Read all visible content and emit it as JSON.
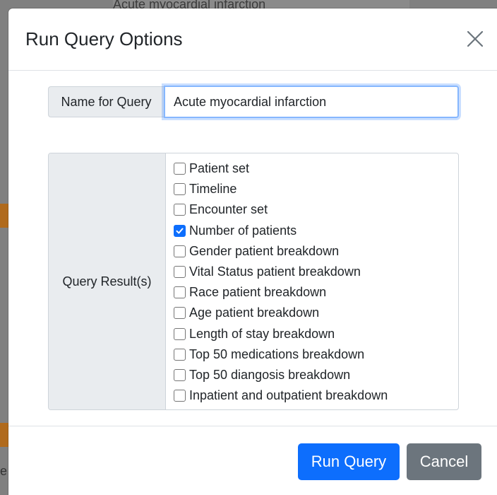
{
  "background": {
    "top_text": "Acute myocardial infarction",
    "edge_char": "e"
  },
  "dialog": {
    "title": "Run Query Options",
    "close_icon": "close-icon"
  },
  "form": {
    "name_label": "Name for Query",
    "name_value": "Acute myocardial infarction",
    "results_label": "Query Result(s)",
    "results": [
      {
        "label": "Patient set",
        "checked": false
      },
      {
        "label": "Timeline",
        "checked": false
      },
      {
        "label": "Encounter set",
        "checked": false
      },
      {
        "label": "Number of patients",
        "checked": true
      },
      {
        "label": "Gender patient breakdown",
        "checked": false
      },
      {
        "label": "Vital Status patient breakdown",
        "checked": false
      },
      {
        "label": "Race patient breakdown",
        "checked": false
      },
      {
        "label": "Age patient breakdown",
        "checked": false
      },
      {
        "label": "Length of stay breakdown",
        "checked": false
      },
      {
        "label": "Top 50 medications breakdown",
        "checked": false
      },
      {
        "label": "Top 50 diangosis breakdown",
        "checked": false
      },
      {
        "label": "Inpatient and outpatient breakdown",
        "checked": false
      }
    ]
  },
  "footer": {
    "run_label": "Run Query",
    "cancel_label": "Cancel"
  },
  "colors": {
    "primary": "#0d6efd",
    "secondary": "#6c757d",
    "label_bg": "#e9ecef",
    "focus_border": "#86b7fe"
  }
}
